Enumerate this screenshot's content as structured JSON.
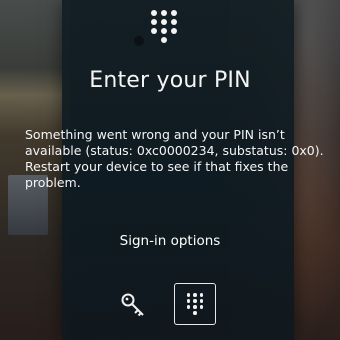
{
  "lock_screen": {
    "title": "Enter your PIN",
    "message": "Something went wrong and your PIN isn’t available (status: 0xc0000234, substatus: 0x0). Restart your device to see if that fixes the problem.",
    "signin_options_label": "Sign-in options",
    "icons": {
      "header": "pin-keypad-icon",
      "password_option": "key-icon",
      "pin_option": "pin-keypad-icon"
    },
    "selected_signin_option": "pin"
  }
}
